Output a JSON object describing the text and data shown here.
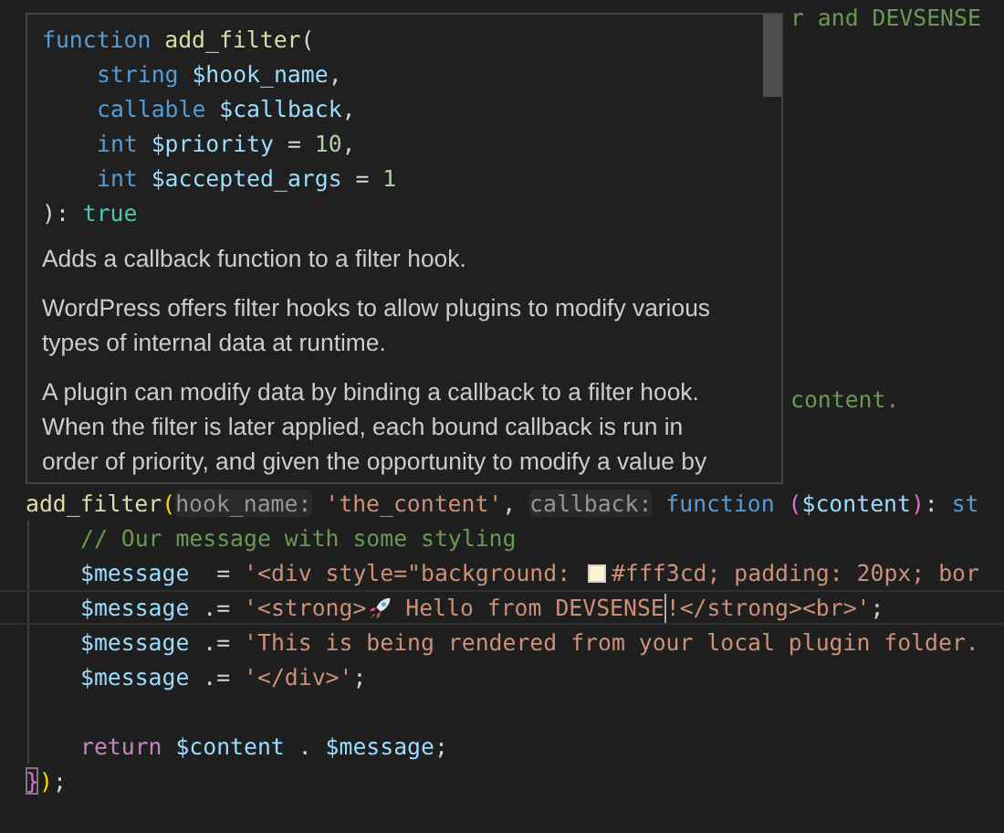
{
  "editor": {
    "lines": [
      {
        "kind": "fragment",
        "tokens": [
          {
            "kind": "comment",
            "text": "r and DEVSENSE"
          }
        ]
      },
      {
        "kind": "fragment",
        "tokens": [
          {
            "kind": "comment",
            "text": "content."
          }
        ]
      },
      {
        "kind": "code",
        "indented": false,
        "current": false,
        "tokens": [
          {
            "kind": "function",
            "text": "add_filter"
          },
          {
            "kind": "bracket1",
            "text": "("
          },
          {
            "kind": "hint",
            "text": "hook_name:"
          },
          {
            "kind": "string",
            "text": " 'the_content'"
          },
          {
            "kind": "plain",
            "text": ", "
          },
          {
            "kind": "hint",
            "text": "callback:"
          },
          {
            "kind": "keyword",
            "text": " function "
          },
          {
            "kind": "bracket2",
            "text": "("
          },
          {
            "kind": "variable",
            "text": "$content"
          },
          {
            "kind": "bracket2",
            "text": ")"
          },
          {
            "kind": "plain",
            "text": ": "
          },
          {
            "kind": "type",
            "text": "st"
          }
        ]
      },
      {
        "kind": "code",
        "indented": true,
        "current": false,
        "tokens": [
          {
            "kind": "comment",
            "text": "// Our message with some styling"
          }
        ]
      },
      {
        "kind": "code",
        "indented": true,
        "current": false,
        "tokens": [
          {
            "kind": "variable",
            "text": "$message"
          },
          {
            "kind": "plain",
            "text": "  = "
          },
          {
            "kind": "string",
            "text": "'<div style=\"background: "
          },
          {
            "kind": "swatch",
            "color": "#fff3cd"
          },
          {
            "kind": "string",
            "text": "#fff3cd; padding: 20px; bor"
          }
        ]
      },
      {
        "kind": "code",
        "indented": true,
        "current": true,
        "tokens": [
          {
            "kind": "variable",
            "text": "$message"
          },
          {
            "kind": "plain",
            "text": " .= "
          },
          {
            "kind": "string",
            "text": "'<strong>"
          },
          {
            "kind": "rocket"
          },
          {
            "kind": "string",
            "text": " Hello from DEVSENSE"
          },
          {
            "kind": "cursor"
          },
          {
            "kind": "string",
            "text": "!</strong><br>'"
          },
          {
            "kind": "plain",
            "text": ";"
          }
        ]
      },
      {
        "kind": "code",
        "indented": true,
        "current": false,
        "tokens": [
          {
            "kind": "variable",
            "text": "$message"
          },
          {
            "kind": "plain",
            "text": " .= "
          },
          {
            "kind": "string",
            "text": "'This is being rendered from your local plugin folder."
          }
        ]
      },
      {
        "kind": "code",
        "indented": true,
        "current": false,
        "tokens": [
          {
            "kind": "variable",
            "text": "$message"
          },
          {
            "kind": "plain",
            "text": " .= "
          },
          {
            "kind": "string",
            "text": "'</div>'"
          },
          {
            "kind": "plain",
            "text": ";"
          }
        ]
      },
      {
        "kind": "blank"
      },
      {
        "kind": "code",
        "indented": true,
        "current": false,
        "tokens": [
          {
            "kind": "control",
            "text": "return "
          },
          {
            "kind": "variable",
            "text": "$content"
          },
          {
            "kind": "plain",
            "text": " . "
          },
          {
            "kind": "variable",
            "text": "$message"
          },
          {
            "kind": "plain",
            "text": ";"
          }
        ]
      },
      {
        "kind": "code",
        "indented": false,
        "current": false,
        "tokens": [
          {
            "kind": "match",
            "text": "}"
          },
          {
            "kind": "bracket1",
            "text": ")"
          },
          {
            "kind": "plain",
            "text": ";"
          }
        ]
      }
    ]
  },
  "hover": {
    "signature": [
      {
        "indented": false,
        "tokens": [
          {
            "kind": "keyword",
            "text": "function "
          },
          {
            "kind": "function",
            "text": "add_filter"
          },
          {
            "kind": "plain",
            "text": "("
          }
        ]
      },
      {
        "indented": true,
        "tokens": [
          {
            "kind": "keyword",
            "text": "string "
          },
          {
            "kind": "variable",
            "text": "$hook_name"
          },
          {
            "kind": "plain",
            "text": ","
          }
        ]
      },
      {
        "indented": true,
        "tokens": [
          {
            "kind": "keyword",
            "text": "callable "
          },
          {
            "kind": "variable",
            "text": "$callback"
          },
          {
            "kind": "plain",
            "text": ","
          }
        ]
      },
      {
        "indented": true,
        "tokens": [
          {
            "kind": "keyword",
            "text": "int "
          },
          {
            "kind": "variable",
            "text": "$priority"
          },
          {
            "kind": "plain",
            "text": " = "
          },
          {
            "kind": "number",
            "text": "10"
          },
          {
            "kind": "plain",
            "text": ","
          }
        ]
      },
      {
        "indented": true,
        "tokens": [
          {
            "kind": "keyword",
            "text": "int "
          },
          {
            "kind": "variable",
            "text": "$accepted_args"
          },
          {
            "kind": "plain",
            "text": " = "
          },
          {
            "kind": "number",
            "text": "1"
          }
        ]
      },
      {
        "indented": false,
        "tokens": [
          {
            "kind": "plain",
            "text": "): "
          },
          {
            "kind": "constant",
            "text": "true"
          }
        ]
      }
    ],
    "description": [
      "Adds a callback function to a filter hook.",
      "WordPress offers filter hooks to allow plugins to modify various types of internal data at runtime.",
      "A plugin can modify data by binding a callback to a filter hook. When the filter is later applied, each bound callback is run in order of priority, and given the opportunity to modify a value by"
    ]
  }
}
